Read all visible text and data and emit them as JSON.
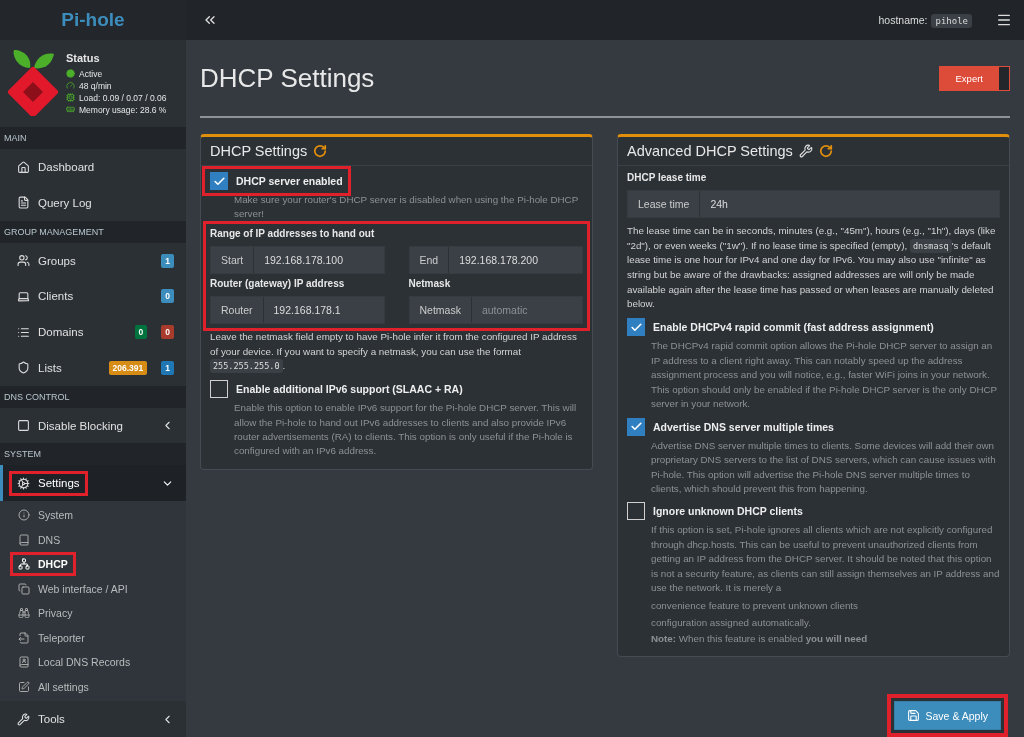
{
  "sidebar": {
    "brand": "Pi-hole",
    "status": {
      "title": "Status",
      "items": [
        "Active",
        "48 q/min",
        "Load: 0.09 / 0.07 / 0.06",
        "Memory usage: 28.6 %"
      ]
    },
    "sections": [
      {
        "title": "MAIN",
        "items": [
          {
            "label": "Dashboard",
            "selected": false
          },
          {
            "label": "Query Log",
            "selected": false
          }
        ]
      },
      {
        "title": "GROUP MANAGEMENT",
        "items": [
          {
            "label": "Groups",
            "selected": false,
            "badges": [
              {
                "text": "1",
                "color": "#3c8dbc"
              }
            ]
          },
          {
            "label": "Clients",
            "selected": false,
            "badges": [
              {
                "text": "0",
                "color": "#3c8dbc"
              }
            ]
          },
          {
            "label": "Domains",
            "selected": false,
            "badges": [
              {
                "text": "0",
                "color": "#00733e"
              },
              {
                "text": "0",
                "color": "#a83b2c"
              }
            ]
          },
          {
            "label": "Lists",
            "selected": false,
            "badges": [
              {
                "text": "206.391",
                "color": "#d68c15"
              },
              {
                "text": "1",
                "color": "#1f78b4"
              }
            ]
          }
        ]
      },
      {
        "title": "DNS CONTROL",
        "items": [
          {
            "label": "Disable Blocking",
            "selected": false,
            "expanded": false
          }
        ]
      },
      {
        "title": "SYSTEM",
        "items": [
          {
            "label": "Settings",
            "selected": true,
            "expanded": true,
            "highlighted": true,
            "children": [
              {
                "label": "System",
                "selected": false
              },
              {
                "label": "DNS",
                "selected": false
              },
              {
                "label": "DHCP",
                "selected": true,
                "highlighted": true
              },
              {
                "label": "Web interface / API",
                "selected": false
              },
              {
                "label": "Privacy",
                "selected": false
              },
              {
                "label": "Teleporter",
                "selected": false
              },
              {
                "label": "Local DNS Records",
                "selected": false
              },
              {
                "label": "All settings",
                "selected": false
              }
            ]
          },
          {
            "label": "Tools",
            "selected": false,
            "expanded": false
          }
        ]
      }
    ]
  },
  "topbar": {
    "hostname_label": "hostname:",
    "hostname": "pihole"
  },
  "page": {
    "title": "DHCP Settings",
    "expert": {
      "label": "Expert",
      "on": true
    }
  },
  "cards": [
    {
      "title": "DHCP Settings",
      "blocks": [
        {
          "kind": "option",
          "label": "DHCP server enabled",
          "checked": true,
          "highlighted": true,
          "description": "Make sure your router's DHCP server is disabled when using the Pi-hole DHCP server!"
        },
        {
          "kind": "fields",
          "highlighted": true,
          "fields": [
            {
              "title": "Range of IP addresses to hand out",
              "addon": "Start",
              "value": "192.168.178.100"
            },
            {
              "addon": "End",
              "value": "192.168.178.200"
            },
            {
              "title": "Router (gateway) IP address",
              "addon": "Router",
              "value": "192.168.178.1"
            },
            {
              "title": "Netmask",
              "addon": "Netmask",
              "placeholder": "automatic"
            }
          ]
        },
        {
          "kind": "help",
          "before": "Leave the netmask field empty to have Pi-hole infer it from the configured IP address of your device. If you want to specify a netmask, you can use the format",
          "code": "255.255.255.0",
          "after": "."
        },
        {
          "kind": "option",
          "label": "Enable additional IPv6 support (SLAAC + RA)",
          "checked": false,
          "description": "Enable this option to enable IPv6 support for the Pi-hole DHCP server. This will allow the Pi-hole to hand out IPv6 addresses to clients and also provide IPv6 router advertisements (RA) to clients. This option is only useful if the Pi-hole is configured with an IPv6 address."
        }
      ]
    },
    {
      "title": "Advanced DHCP Settings",
      "blocks": [
        {
          "kind": "fields",
          "fields": [
            {
              "title": "DHCP lease time",
              "addon": "Lease time",
              "value": "24h"
            }
          ]
        },
        {
          "kind": "help",
          "before": "The lease time can be in seconds, minutes (e.g., \"45m\"), hours (e.g., \"1h\"), days (like \"2d\"), or even weeks (\"1w\"). If no lease time is specified (empty),",
          "code": "dnsmasq",
          "after": "'s default lease time is one hour for IPv4 and one day for IPv6. You may also use \"infinite\" as string but be aware of the drawbacks: assigned addresses are will only be made available again after the lease time has passed or when leases are manually deleted below."
        },
        {
          "kind": "option",
          "label": "Enable DHCPv4 rapid commit (fast address assignment)",
          "checked": true,
          "description": "The DHCPv4 rapid commit option allows the Pi-hole DHCP server to assign an IP address to a client right away. This can notably speed up the address assignment process and you will notice, e.g., faster WiFi joins in your network. This option should only be enabled if the Pi-hole DHCP server is the only DHCP server in your network."
        },
        {
          "kind": "option",
          "label": "Advertise DNS server multiple times",
          "checked": true,
          "description": "Advertise DNS server multiple times to clients. Some devices will add their own proprietary DNS servers to the list of DNS servers, which can cause issues with Pi-hole. This option will advertise the Pi-hole DNS server multiple times to clients, which should prevent this from happening."
        },
        {
          "kind": "option",
          "label": "Ignore unknown DHCP clients",
          "checked": false,
          "description": "If this option is set, Pi-hole ignores all clients which are not explicitly configured through dhcp.hosts. This can be useful to prevent unauthorized clients from getting an IP address from the DHCP server. It should be noted that this option is not a security feature, as clients can still assign themselves an IP address and use the network. It is merely a",
          "more": [
            "convenience feature to prevent unknown clients",
            "configuration assigned automatically."
          ],
          "note": "**Note:** When this feature is enabled **you will need**"
        }
      ]
    }
  ],
  "save": {
    "label": "Save & Apply",
    "highlighted": true
  }
}
